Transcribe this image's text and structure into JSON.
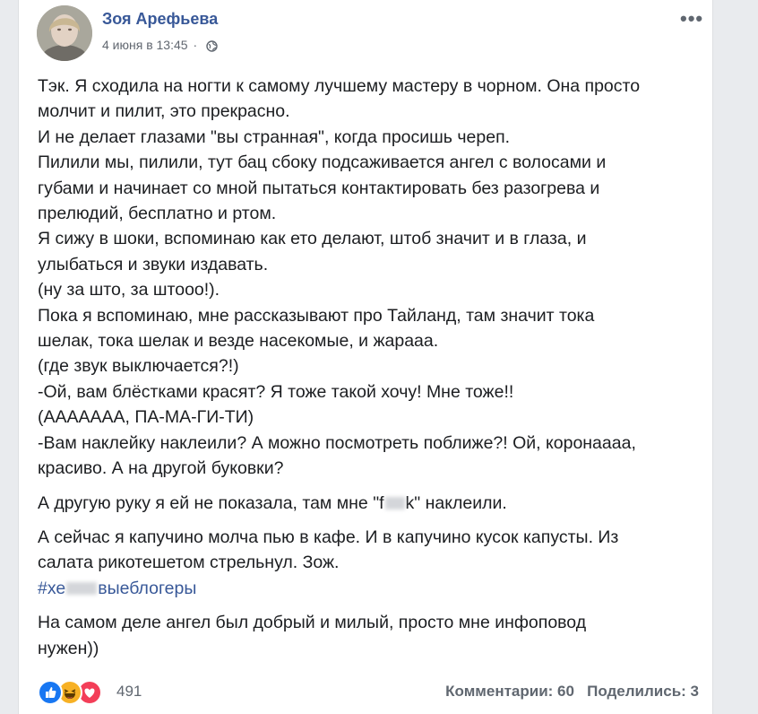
{
  "post": {
    "author": "Зоя Арефьева",
    "date": "4 июня в 13:45",
    "separator": "·",
    "more_label": "•••",
    "paragraphs": [
      [
        "Тэк. Я сходила на ногти к самому лучшему мастеру в чорном. Она просто",
        "молчит и пилит, это прекрасно.",
        "И не делает глазами \"вы странная\", когда просишь череп.",
        "Пилили мы, пилили, тут бац сбоку подсаживается ангел с волосами и",
        "губами и начинает со мной пытаться контактировать без разогрева и",
        "прелюдий, бесплатно и ртом.",
        "Я сижу в шоки, вспоминаю как ето делают, штоб значит и в глаза, и",
        "улыбаться и звуки издавать.",
        "(ну за што, за штооо!).",
        "Пока я вспоминаю, мне рассказывают про Тайланд, там значит тока",
        "шелак, тока шелак и везде насекомые, и жараaa.",
        "(где звук выключается?!)",
        "-Ой, вам блёстками красят? Я тоже такой хочу! Мне тоже!!",
        "(АААААAA, ПА-МА-ГИ-ТИ)",
        "-Вам наклейку наклеили? А можно посмотреть поближе?! Ой, коронаааа,",
        "красиво. А на другой буковки?"
      ]
    ],
    "p2": {
      "before": "А другую руку я ей не показала, там мне \"f",
      "after": "k\" наклеили."
    },
    "p3": [
      "А сейчас я капучино молча пью в кафе. И в капучино кусок капусты. Из",
      "салата рикотешетом стрельнул. Зож."
    ],
    "hashtag": {
      "before": "#хе",
      "after": "выеблогеры"
    },
    "p4": [
      "На самом деле ангел был добрый и милый, просто мне инфоповод",
      "нужен))"
    ],
    "reactions": {
      "count": "491",
      "types": [
        "like",
        "haha",
        "love"
      ]
    },
    "comments": "Комментарии: 60",
    "shares": "Поделились: 3"
  },
  "colors": {
    "link": "#385898",
    "text": "#1c1e21",
    "secondary": "#606770",
    "like": "#1877f2",
    "love": "#f33e58",
    "haha": "#f7b125"
  }
}
